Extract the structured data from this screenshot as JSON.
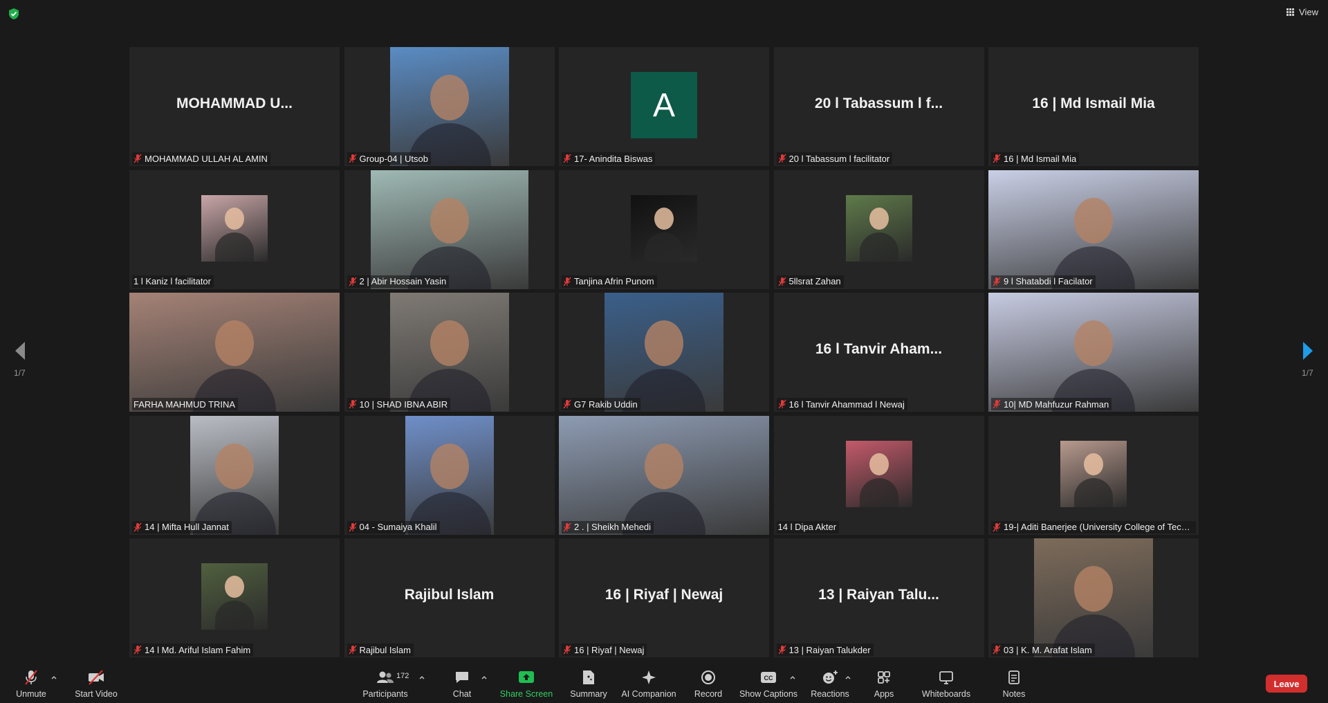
{
  "topbar": {
    "view_label": "View"
  },
  "pagination": {
    "left": "1/7",
    "right": "1/7"
  },
  "tiles": [
    {
      "big": "MOHAMMAD  U...",
      "name": "MOHAMMAD ULLAH AL AMIN",
      "muted": true,
      "kind": "text"
    },
    {
      "big": "",
      "name": "Group-04 | Utsob",
      "muted": true,
      "kind": "photo",
      "color": "#5a8cc4"
    },
    {
      "big": "A",
      "name": "17- Anindita Biswas",
      "muted": true,
      "kind": "letter",
      "color": "#0c5a47"
    },
    {
      "big": "20 l Tabassum l f...",
      "name": "20 l Tabassum l facilitator",
      "muted": true,
      "kind": "text"
    },
    {
      "big": "16 | Md Ismail Mia",
      "name": "16 | Md Ismail Mia",
      "muted": true,
      "kind": "text"
    },
    {
      "big": "",
      "name": "1 l Kaniz l facilitator",
      "muted": false,
      "kind": "avatar",
      "color": "#c9a6a8"
    },
    {
      "big": "",
      "name": "2 | Abir Hossain Yasin",
      "muted": true,
      "kind": "photo",
      "color": "#9fb9b4"
    },
    {
      "big": "",
      "name": "Tanjina Afrin Punom",
      "muted": true,
      "kind": "avatar",
      "color": "#111111"
    },
    {
      "big": "",
      "name": "5llsrat Zahan",
      "muted": true,
      "kind": "avatar",
      "color": "#5f7a4a"
    },
    {
      "big": "",
      "name": "9 l Shatabdi l Facilator",
      "muted": true,
      "kind": "video",
      "color": "#c9cfe6"
    },
    {
      "big": "",
      "name": "FARHA MAHMUD TRINA",
      "muted": false,
      "kind": "video",
      "color": "#a58276",
      "active": true
    },
    {
      "big": "",
      "name": "10 | SHAD IBNA ABIR",
      "muted": true,
      "kind": "photo",
      "color": "#7f7a74"
    },
    {
      "big": "",
      "name": "G7 Rakib Uddin",
      "muted": true,
      "kind": "photo",
      "color": "#3a5f8a"
    },
    {
      "big": "16 l Tanvir Aham...",
      "name": "16 l Tanvir Ahammad l Newaj",
      "muted": true,
      "kind": "text"
    },
    {
      "big": "",
      "name": "10| MD Mahfuzur Rahman",
      "muted": true,
      "kind": "video",
      "color": "#c7cbe2"
    },
    {
      "big": "",
      "name": "14 | Mifta Hull Jannat",
      "muted": true,
      "kind": "photo",
      "color": "#b9bdc4"
    },
    {
      "big": "",
      "name": "04 - Sumaiya Khalil",
      "muted": true,
      "kind": "photo",
      "color": "#6f8fc9"
    },
    {
      "big": "",
      "name": "2 . | Sheikh Mehedi",
      "muted": true,
      "kind": "video",
      "color": "#8d9bb2"
    },
    {
      "big": "",
      "name": "14 l Dipa Akter",
      "muted": false,
      "kind": "avatar",
      "color": "#c45a6a"
    },
    {
      "big": "",
      "name": "19-| Aditi Banerjee (University College of Tech...",
      "muted": true,
      "kind": "avatar",
      "color": "#b89a8e"
    },
    {
      "big": "",
      "name": "14 l Md. Ariful Islam Fahim",
      "muted": true,
      "kind": "avatar",
      "color": "#51603f"
    },
    {
      "big": "Rajibul Islam",
      "name": "Rajibul Islam",
      "muted": true,
      "kind": "text"
    },
    {
      "big": "16 | Riyaf | Newaj",
      "name": "16 | Riyaf | Newaj",
      "muted": true,
      "kind": "text"
    },
    {
      "big": "13 | Raiyan Talu...",
      "name": "13 | Raiyan Talukder",
      "muted": true,
      "kind": "text"
    },
    {
      "big": "",
      "name": "03 | K. M. Arafat Islam",
      "muted": true,
      "kind": "photo",
      "color": "#7d6b5a"
    }
  ],
  "toolbar": {
    "unmute": "Unmute",
    "start_video": "Start Video",
    "participants": "Participants",
    "participants_count": "172",
    "chat": "Chat",
    "share_screen": "Share Screen",
    "summary": "Summary",
    "ai_companion": "AI Companion",
    "record": "Record",
    "show_captions": "Show Captions",
    "reactions": "Reactions",
    "apps": "Apps",
    "whiteboards": "Whiteboards",
    "notes": "Notes",
    "leave": "Leave"
  }
}
